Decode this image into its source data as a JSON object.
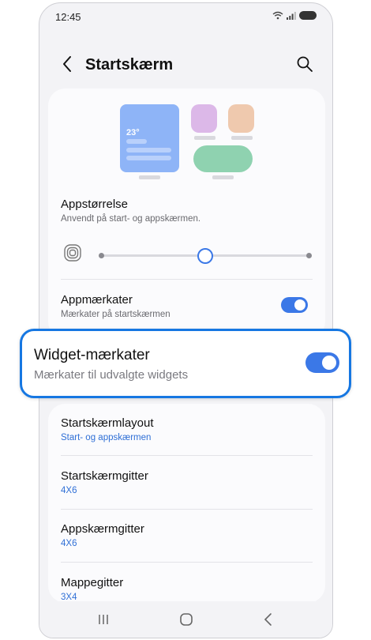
{
  "status_bar": {
    "time": "12:45"
  },
  "header": {
    "title": "Startskærm"
  },
  "app_size": {
    "title": "Appstørrelse",
    "subtitle": "Anvendt på start- og appskærmen.",
    "slider_value": 0.5
  },
  "preview": {
    "temperature": "23°"
  },
  "app_badges": {
    "title": "Appmærkater",
    "subtitle": "Mærkater på startskærmen",
    "on": true
  },
  "widget_badges": {
    "title": "Widget-mærkater",
    "subtitle": "Mærkater til udvalgte widgets",
    "on": true
  },
  "settings": [
    {
      "title": "Startskærmlayout",
      "value": "Start- og appskærmen"
    },
    {
      "title": "Startskærmgitter",
      "value": "4X6"
    },
    {
      "title": "Appskærmgitter",
      "value": "4X6"
    },
    {
      "title": "Mappegitter",
      "value": "3X4"
    }
  ],
  "colors": {
    "accent": "#3b78e7",
    "highlight_border": "#1677e2",
    "link": "#2f6fd6"
  }
}
